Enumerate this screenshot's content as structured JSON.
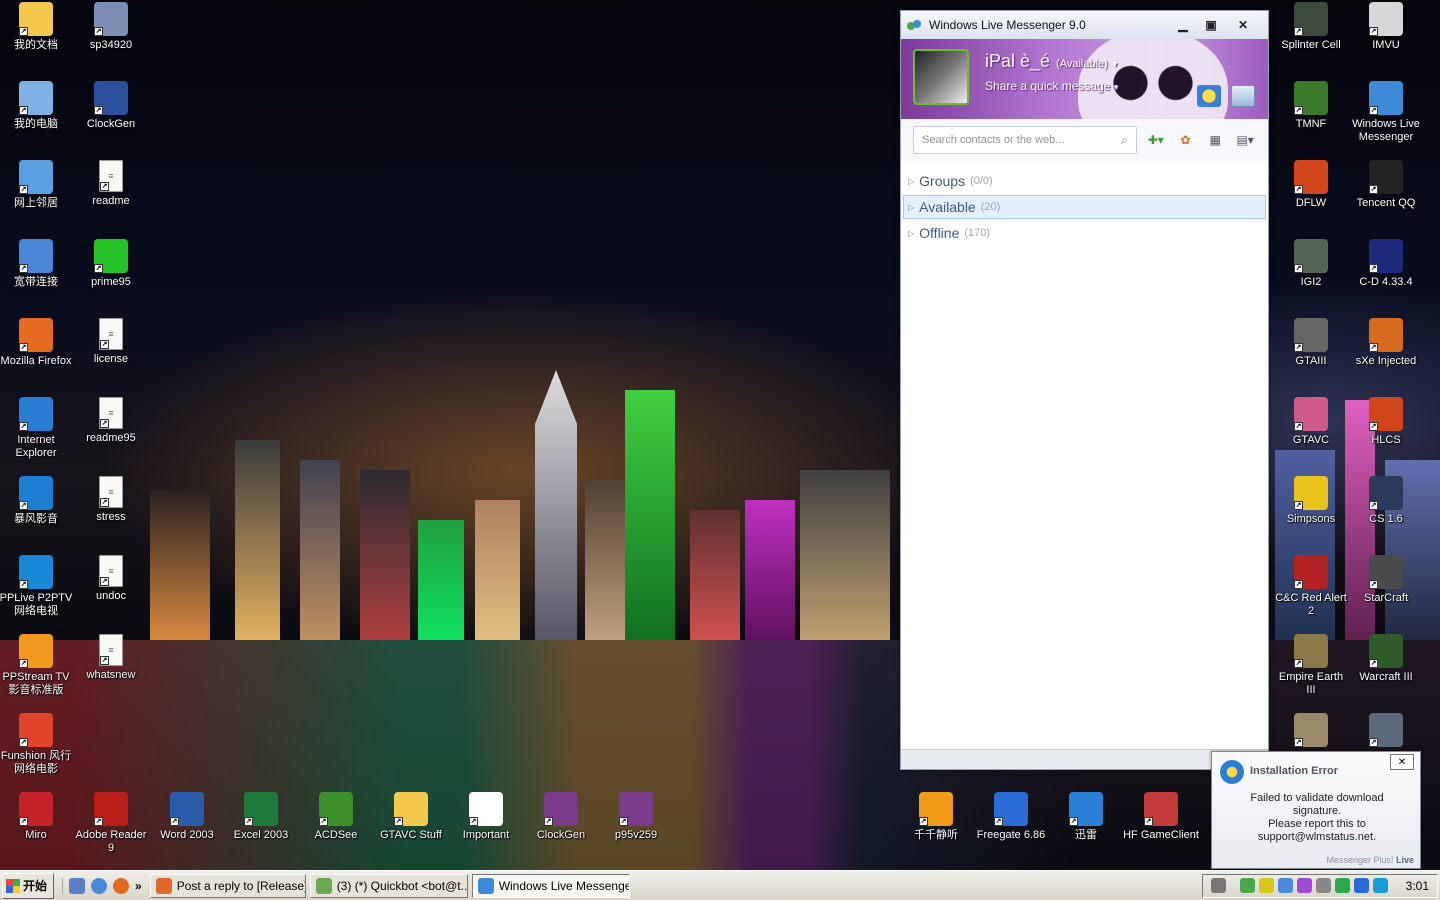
{
  "desktop": {
    "left_icons": [
      {
        "label": "我的文档",
        "color": "#f2c94c",
        "kind": "folder"
      },
      {
        "label": "sp34920",
        "color": "#7a8fb3",
        "kind": "app"
      },
      {
        "label": "我的电脑",
        "color": "#7fb0e6",
        "kind": "app"
      },
      {
        "label": "ClockGen",
        "color": "#2c4f9e",
        "kind": "app"
      },
      {
        "label": "网上邻居",
        "color": "#5aa0e0",
        "kind": "app"
      },
      {
        "label": "readme",
        "color": "#ffffff",
        "kind": "doc"
      },
      {
        "label": "宽带连接",
        "color": "#4a86d6",
        "kind": "app"
      },
      {
        "label": "prime95",
        "color": "#27c227",
        "kind": "app"
      },
      {
        "label": "Mozilla Firefox",
        "color": "#e66a1f",
        "kind": "app"
      },
      {
        "label": "license",
        "color": "#ffffff",
        "kind": "doc"
      },
      {
        "label": "Internet Explorer",
        "color": "#2b7cd3",
        "kind": "app"
      },
      {
        "label": "readme95",
        "color": "#ffffff",
        "kind": "doc"
      },
      {
        "label": "暴风影音",
        "color": "#1c7fd4",
        "kind": "app"
      },
      {
        "label": "stress",
        "color": "#ffffff",
        "kind": "doc"
      },
      {
        "label": "PPLive P2PTV 网络电视",
        "color": "#1a88d8",
        "kind": "app"
      },
      {
        "label": "undoc",
        "color": "#ffffff",
        "kind": "doc"
      },
      {
        "label": "PPStream TV 影音标准版",
        "color": "#f29a1d",
        "kind": "app"
      },
      {
        "label": "whatsnew",
        "color": "#ffffff",
        "kind": "doc"
      },
      {
        "label": "Funshion 风行网络电影",
        "color": "#e0442b",
        "kind": "app"
      }
    ],
    "bottom_icons": [
      {
        "label": "Miro",
        "color": "#c4232a"
      },
      {
        "label": "Adobe Reader 9",
        "color": "#b81d18"
      },
      {
        "label": "Word 2003",
        "color": "#2a5caa"
      },
      {
        "label": "Excel 2003",
        "color": "#1d7a3a"
      },
      {
        "label": "ACDSee",
        "color": "#3d8f2a"
      },
      {
        "label": "GTAVC Stuff",
        "color": "#f2c94c"
      },
      {
        "label": "Important",
        "color": "#ffffff"
      },
      {
        "label": "ClockGen",
        "color": "#7a3b8a"
      },
      {
        "label": "p95v259",
        "color": "#7a3b8a"
      },
      {
        "label": "千千静听",
        "color": "#f09a1a"
      },
      {
        "label": "Freegate 6.86",
        "color": "#2a6cd6"
      },
      {
        "label": "迅雷",
        "color": "#2a7fd6"
      },
      {
        "label": "HF GameClient",
        "color": "#c23a3a"
      }
    ],
    "right_icons": [
      {
        "label": "Splinter Cell",
        "color": "#3b4a3b"
      },
      {
        "label": "IMVU",
        "color": "#d7d7d7"
      },
      {
        "label": "TMNF",
        "color": "#3a7a2a"
      },
      {
        "label": "Windows Live Messenger",
        "color": "#3d8ad6"
      },
      {
        "label": "DFLW",
        "color": "#d2461c"
      },
      {
        "label": "Tencent QQ",
        "color": "#222222"
      },
      {
        "label": "IGI2",
        "color": "#556655"
      },
      {
        "label": "C-D 4.33.4",
        "color": "#1b2a7a"
      },
      {
        "label": "GTAIII",
        "color": "#666666"
      },
      {
        "label": "sXe Injected",
        "color": "#d86a1d"
      },
      {
        "label": "GTAVC",
        "color": "#d05a8a"
      },
      {
        "label": "HLCS",
        "color": "#d0451b"
      },
      {
        "label": "Simpsons",
        "color": "#e8c41a"
      },
      {
        "label": "CS 1.6",
        "color": "#2a3a5a"
      },
      {
        "label": "C&C Red Alert 2",
        "color": "#b22222"
      },
      {
        "label": "StarCraft",
        "color": "#4a4a4a"
      },
      {
        "label": "Empire Earth III",
        "color": "#8a7a4a"
      },
      {
        "label": "Warcraft III",
        "color": "#2f5a2a"
      },
      {
        "label": "",
        "color": "#9a8a6a"
      },
      {
        "label": "",
        "color": "#5a6a7a"
      }
    ]
  },
  "messenger": {
    "title": "Windows Live Messenger 9.0",
    "username": "iPal è_é",
    "status": "(Available)",
    "quick_message": "Share a quick message",
    "search_placeholder": "Search contacts or the web...",
    "groups": [
      {
        "name": "Groups",
        "count": "(0/0)",
        "selected": false
      },
      {
        "name": "Available",
        "count": "(20)",
        "selected": true
      },
      {
        "name": "Offline",
        "count": "(170)",
        "selected": false
      }
    ],
    "accent": "#b276d1"
  },
  "toast": {
    "title": "Installation Error",
    "body_lines": [
      "Failed to validate download",
      "signature.",
      "Please report this to",
      "support@wlmstatus.net."
    ],
    "footer_prefix": "Messenger Plus!",
    "footer_brand": "Live"
  },
  "taskbar": {
    "start_label": "开始",
    "more": "»",
    "tasks": [
      {
        "label": "Post a reply to [Release]...",
        "color": "#e0662a",
        "active": false
      },
      {
        "label": "(3) (*) Quickbot <bot@t...",
        "color": "#6aa84f",
        "active": false
      },
      {
        "label": "Windows Live Messenger...",
        "color": "#3d8ad6",
        "active": true
      }
    ],
    "clock": "3:01"
  }
}
